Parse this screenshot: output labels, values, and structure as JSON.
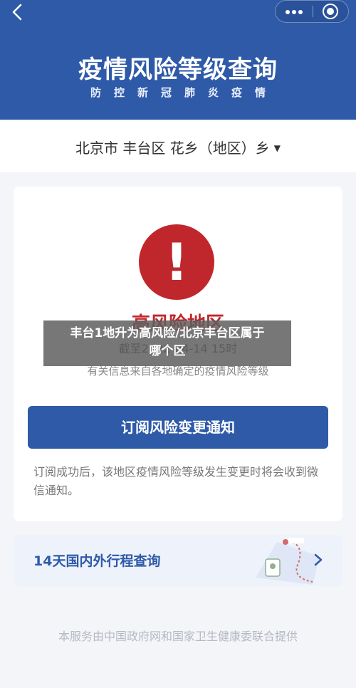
{
  "header": {
    "back_glyph": "‹",
    "title": "疫情风险等级查询",
    "subtitle": "防控新冠肺炎疫情"
  },
  "region": {
    "text": "北京市 丰台区 花乡（地区）乡",
    "caret": "▼"
  },
  "card": {
    "alert_glyph": "!",
    "risk_level": "高风险地区",
    "deadline": "截至2022-04-14 15时",
    "source_note": "有关信息来自各地确定的疫情风险等级",
    "subscribe_button": "订阅风险变更通知",
    "subscribe_note": "订阅成功后，该地区疫情风险等级发生变更时将会收到微信通知。"
  },
  "travel": {
    "label": "14天国内外行程查询",
    "arrow": "›"
  },
  "footer": "本服务由中国政府网和国家卫生健康委联合提供",
  "overlay": {
    "line1": "丰台1地升为高风险/北京丰台区属于",
    "line2": "哪个区"
  },
  "colors": {
    "brand_blue": "#2e5aa8",
    "alert_red": "#c0272c"
  },
  "icons": [
    "back-icon",
    "more-icon",
    "close-target-icon",
    "alert-icon",
    "map-route-icon",
    "chevron-right-icon"
  ]
}
